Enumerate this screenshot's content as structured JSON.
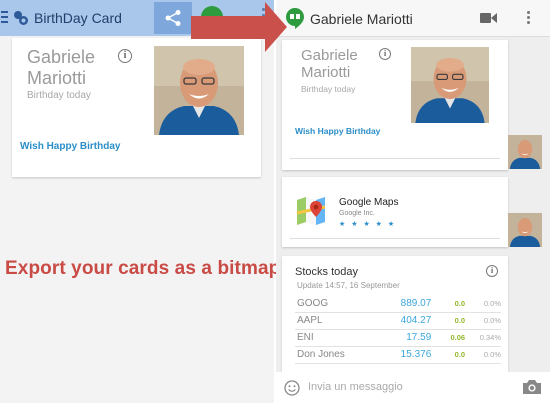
{
  "left": {
    "app_title": "BirthDay Card",
    "card": {
      "name_line1": "Gabriele",
      "name_line2": "Mariotti",
      "subtitle": "Birthday today",
      "info_glyph": "i",
      "action": "Wish Happy Birthday"
    },
    "caption": "Export your cards as a bitmap",
    "caption_color": "#c94b45"
  },
  "right": {
    "contact_name": "Gabriele Mariotti",
    "birthday_card": {
      "name_line1": "Gabriele",
      "name_line2": "Mariotti",
      "subtitle": "Birthday today",
      "info_glyph": "i",
      "action": "Wish Happy Birthday"
    },
    "maps_card": {
      "title": "Google Maps",
      "publisher": "Google Inc.",
      "stars": "★ ★ ★ ★ ★"
    },
    "stocks_card": {
      "title": "Stocks today",
      "update": "Update 14:57, 16 September",
      "info_glyph": "i",
      "rows": [
        {
          "symbol": "GOOG",
          "value": "889.07",
          "change": "0.0",
          "percent": "0.0%"
        },
        {
          "symbol": "AAPL",
          "value": "404.27",
          "change": "0.0",
          "percent": "0.0%"
        },
        {
          "symbol": "ENI",
          "value": "17.59",
          "change": "0.06",
          "percent": "0.34%"
        },
        {
          "symbol": "Don Jones",
          "value": "15.376",
          "change": "0.0",
          "percent": "0.0%"
        }
      ]
    },
    "compose_placeholder": "Invia un messaggio"
  },
  "colors": {
    "accent_blue": "#2a8ec7",
    "hangouts_green": "#2e9b3e",
    "arrow_red": "#c9504b",
    "left_appbar": "#a9c7ea"
  },
  "icons": {
    "menu": "hamburger-icon",
    "app": "app-logo-icon",
    "share": "share-icon",
    "hangouts": "hangouts-icon",
    "video": "video-camera-icon",
    "more": "more-vert-icon",
    "info": "info-icon",
    "maps": "google-maps-icon",
    "emoji": "emoji-icon",
    "camera": "camera-icon"
  }
}
